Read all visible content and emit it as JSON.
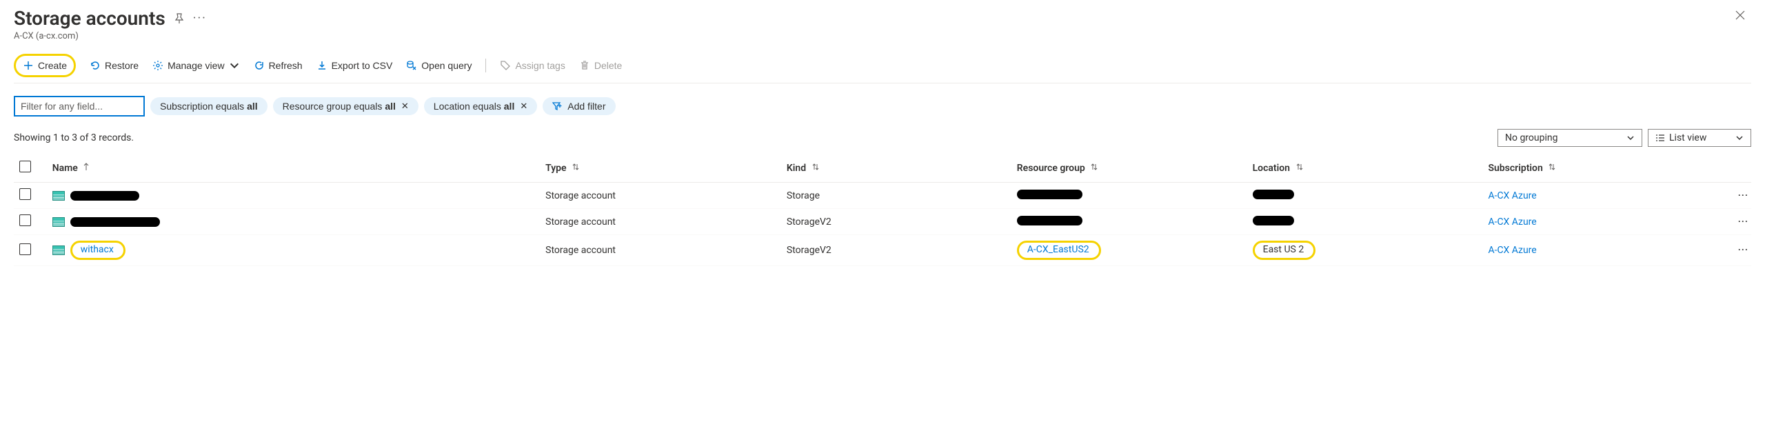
{
  "page": {
    "title": "Storage accounts",
    "subtitle": "A-CX (a-cx.com)"
  },
  "toolbar": {
    "create": "Create",
    "restore": "Restore",
    "manage_view": "Manage view",
    "refresh": "Refresh",
    "export": "Export to CSV",
    "open_query": "Open query",
    "assign_tags": "Assign tags",
    "delete": "Delete"
  },
  "filters": {
    "input_placeholder": "Filter for any field...",
    "subscription_prefix": "Subscription equals ",
    "subscription_val": "all",
    "rg_prefix": "Resource group equals ",
    "rg_val": "all",
    "location_prefix": "Location equals ",
    "location_val": "all",
    "add_filter": "Add filter"
  },
  "status": {
    "showing": "Showing 1 to 3 of 3 records."
  },
  "view": {
    "grouping": "No grouping",
    "list_view": "List view"
  },
  "columns": {
    "name": "Name",
    "type": "Type",
    "kind": "Kind",
    "resource_group": "Resource group",
    "location": "Location",
    "subscription": "Subscription"
  },
  "rows": [
    {
      "name_redacted": true,
      "name": "",
      "type": "Storage account",
      "kind": "Storage",
      "rg_redacted": true,
      "rg": "",
      "loc_redacted": true,
      "location": "",
      "subscription": "A-CX Azure",
      "highlight_name": false,
      "highlight_rg": false,
      "highlight_loc": false
    },
    {
      "name_redacted": true,
      "name": "",
      "type": "Storage account",
      "kind": "StorageV2",
      "rg_redacted": true,
      "rg": "",
      "loc_redacted": true,
      "location": "",
      "subscription": "A-CX Azure",
      "highlight_name": false,
      "highlight_rg": false,
      "highlight_loc": false
    },
    {
      "name_redacted": false,
      "name": "withacx",
      "type": "Storage account",
      "kind": "StorageV2",
      "rg_redacted": false,
      "rg": "A-CX_EastUS2",
      "loc_redacted": false,
      "location": "East US 2",
      "subscription": "A-CX Azure",
      "highlight_name": true,
      "highlight_rg": true,
      "highlight_loc": true
    }
  ]
}
